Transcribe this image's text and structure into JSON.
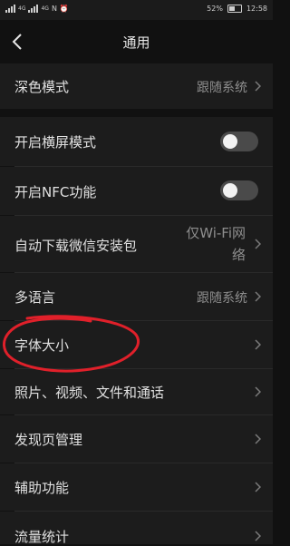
{
  "status_bar": {
    "left_icons": [
      "signal-icon",
      "signal-icon",
      "nfc-icon",
      "alarm-icon"
    ],
    "signal_labels": [
      "4G",
      "4G"
    ],
    "battery": "52%",
    "time": "12:58"
  },
  "header": {
    "back_icon": "chevron-left-icon",
    "title": "通用"
  },
  "settings": {
    "dark_mode": {
      "label": "深色模式",
      "value": "跟随系统"
    },
    "landscape": {
      "label": "开启横屏模式",
      "enabled": false
    },
    "nfc": {
      "label": "开启NFC功能",
      "enabled": false
    },
    "auto_download": {
      "label": "自动下载微信安装包",
      "value_line1": "仅Wi-Fi网",
      "value_line2": "络"
    },
    "language": {
      "label": "多语言",
      "value": "跟随系统"
    },
    "font_size": {
      "label": "字体大小"
    },
    "media": {
      "label": "照片、视频、文件和通话"
    },
    "discover": {
      "label": "发现页管理"
    },
    "accessibility": {
      "label": "辅助功能"
    },
    "traffic": {
      "label": "流量统计"
    }
  },
  "annotation": {
    "color": "#e0202a",
    "target": "字体大小"
  },
  "colors": {
    "background": "#111111",
    "row": "#1c1c1c",
    "text": "#e0e0e0",
    "secondary": "#8e8e8e",
    "toggle_off": "#4a4a4a"
  }
}
